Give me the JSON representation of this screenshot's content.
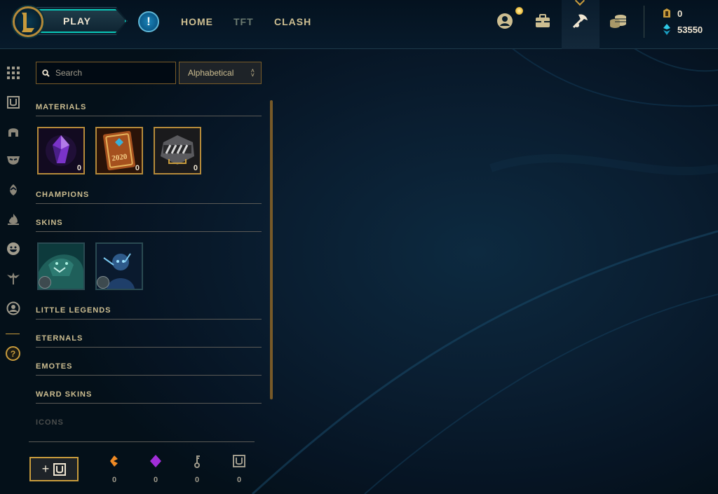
{
  "colors": {
    "gold": "#c89b3c",
    "teal": "#0ac8b9",
    "text": "#cdbe91",
    "bg": "#010a13"
  },
  "header": {
    "logo_icon": "league-logo",
    "play_label": "PLAY",
    "alert_glyph": "!",
    "nav": [
      {
        "label": "HOME",
        "active": true
      },
      {
        "label": "TFT",
        "active": false
      },
      {
        "label": "CLASH",
        "active": true
      }
    ],
    "icons": [
      "profile-icon",
      "collection-icon",
      "loot-icon",
      "store-icon"
    ],
    "currency": {
      "rp": "0",
      "blue_essence": "53550"
    }
  },
  "sidebar": {
    "icons": [
      "grid-icon",
      "chest-icon",
      "helmet-icon",
      "mask-icon",
      "egg-icon",
      "flame-icon",
      "emote-icon",
      "ward-icon",
      "profile-icon"
    ],
    "help_glyph": "?"
  },
  "search": {
    "placeholder": "Search",
    "sort_value": "Alphabetical"
  },
  "sections": {
    "materials": "MATERIALS",
    "champions": "CHAMPIONS",
    "skins": "SKINS",
    "little_legends": "LITTLE LEGENDS",
    "eternals": "ETERNALS",
    "emotes": "EMOTES",
    "ward_skins": "WARD SKINS",
    "icons": "ICONS"
  },
  "materials": [
    {
      "name": "mythic-essence",
      "count": "0"
    },
    {
      "name": "event-token-2020",
      "count": "0"
    },
    {
      "name": "hextech-chest",
      "count": "0"
    }
  ],
  "materials_badge_text": "2020",
  "skins": [
    {
      "name": "skin-shard-1"
    },
    {
      "name": "skin-shard-2"
    }
  ],
  "footer": {
    "craft_plus": "+",
    "resources": [
      {
        "icon": "orange-essence-icon",
        "value": "0"
      },
      {
        "icon": "mythic-essence-icon",
        "value": "0"
      },
      {
        "icon": "key-icon",
        "value": "0"
      },
      {
        "icon": "chest-icon",
        "value": "0"
      }
    ]
  }
}
